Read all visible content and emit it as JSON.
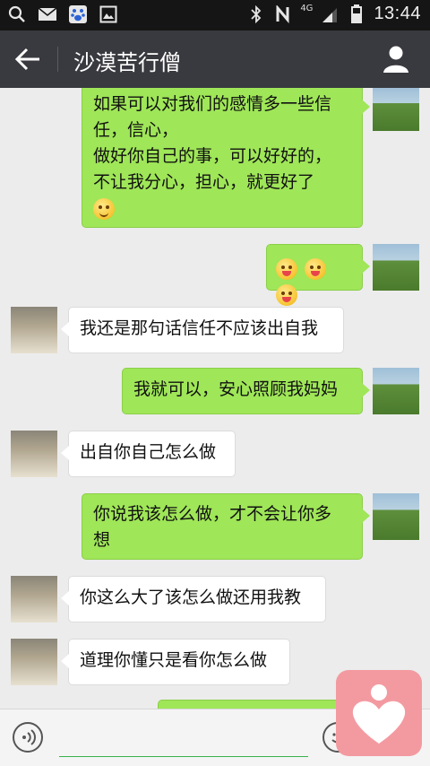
{
  "status_bar": {
    "network": "4G",
    "time": "13:44"
  },
  "header": {
    "title": "沙漠苦行僧"
  },
  "messages": [
    {
      "side": "right",
      "text_lines": [
        "如果可以对我们的感情多一些信",
        "任，信心，",
        "做好你自己的事，可以好好的，",
        "不让我分心，担心，就更好了"
      ],
      "emoji": [
        "smile"
      ]
    },
    {
      "side": "right",
      "emoji": [
        "wink",
        "wink",
        "wink"
      ]
    },
    {
      "side": "left",
      "text": "我还是那句话信任不应该出自我"
    },
    {
      "side": "right",
      "text": "我就可以，安心照顾我妈妈"
    },
    {
      "side": "left",
      "text": "出自你自己怎么做"
    },
    {
      "side": "right",
      "text_lines": [
        "你说我该怎么做，才不会让你多",
        "想"
      ]
    },
    {
      "side": "left",
      "text": "你这么大了该怎么做还用我教"
    },
    {
      "side": "left",
      "text": "道理你懂只是看你怎么做"
    }
  ],
  "icons": {
    "search": "search-icon",
    "mail": "mail-icon",
    "baidu": "paw-icon",
    "gallery": "image-icon",
    "bluetooth": "bluetooth-icon",
    "nfc": "n-icon",
    "signal": "signal-icon",
    "battery": "battery-icon",
    "back": "arrow-left-icon",
    "profile": "person-icon",
    "voice": "voice-icon",
    "emoji": "emoji-icon",
    "float": "heart-icon"
  },
  "colors": {
    "title_bar": "#393a3f",
    "bubble_sent": "#9fe658",
    "bubble_received": "#ffffff",
    "chat_bg": "#ececec"
  }
}
